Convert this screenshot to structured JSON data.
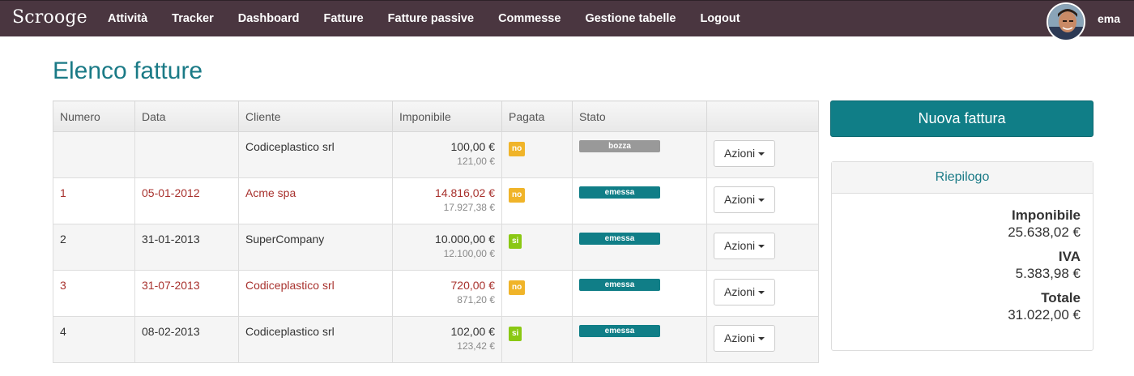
{
  "navbar": {
    "brand": "Scrooge",
    "links": [
      "Attività",
      "Tracker",
      "Dashboard",
      "Fatture",
      "Fatture passive",
      "Commesse",
      "Gestione tabelle",
      "Logout"
    ],
    "username": "ema"
  },
  "page": {
    "title": "Elenco fatture"
  },
  "table": {
    "headers": [
      "Numero",
      "Data",
      "Cliente",
      "Imponibile",
      "Pagata",
      "Stato",
      ""
    ],
    "rows": [
      {
        "numero": "",
        "data": "",
        "cliente": "Codiceplastico srl",
        "imponibile": "100,00 €",
        "totale": "121,00 €",
        "pagata": "no",
        "stato": "bozza",
        "azioni": "Azioni"
      },
      {
        "numero": "1",
        "data": "05-01-2012",
        "cliente": "Acme spa",
        "imponibile": "14.816,02 €",
        "totale": "17.927,38 €",
        "pagata": "no",
        "stato": "emessa",
        "azioni": "Azioni"
      },
      {
        "numero": "2",
        "data": "31-01-2013",
        "cliente": "SuperCompany",
        "imponibile": "10.000,00 €",
        "totale": "12.100,00 €",
        "pagata": "si",
        "stato": "emessa",
        "azioni": "Azioni"
      },
      {
        "numero": "3",
        "data": "31-07-2013",
        "cliente": "Codiceplastico srl",
        "imponibile": "720,00 €",
        "totale": "871,20 €",
        "pagata": "no",
        "stato": "emessa",
        "azioni": "Azioni"
      },
      {
        "numero": "4",
        "data": "08-02-2013",
        "cliente": "Codiceplastico srl",
        "imponibile": "102,00 €",
        "totale": "123,42 €",
        "pagata": "si",
        "stato": "emessa",
        "azioni": "Azioni"
      }
    ]
  },
  "actions": {
    "new_invoice": "Nuova fattura"
  },
  "summary": {
    "title": "Riepilogo",
    "imponibile_label": "Imponibile",
    "imponibile_value": "25.638,02 €",
    "iva_label": "IVA",
    "iva_value": "5.383,98 €",
    "totale_label": "Totale",
    "totale_value": "31.022,00 €"
  },
  "colors": {
    "navbar": "#4a3640",
    "accent": "#107e87",
    "overdue_text": "#a8322e",
    "badge_no": "#f0b429",
    "badge_si": "#8ac813",
    "status_bozza": "#999999",
    "status_emessa": "#107e87"
  }
}
